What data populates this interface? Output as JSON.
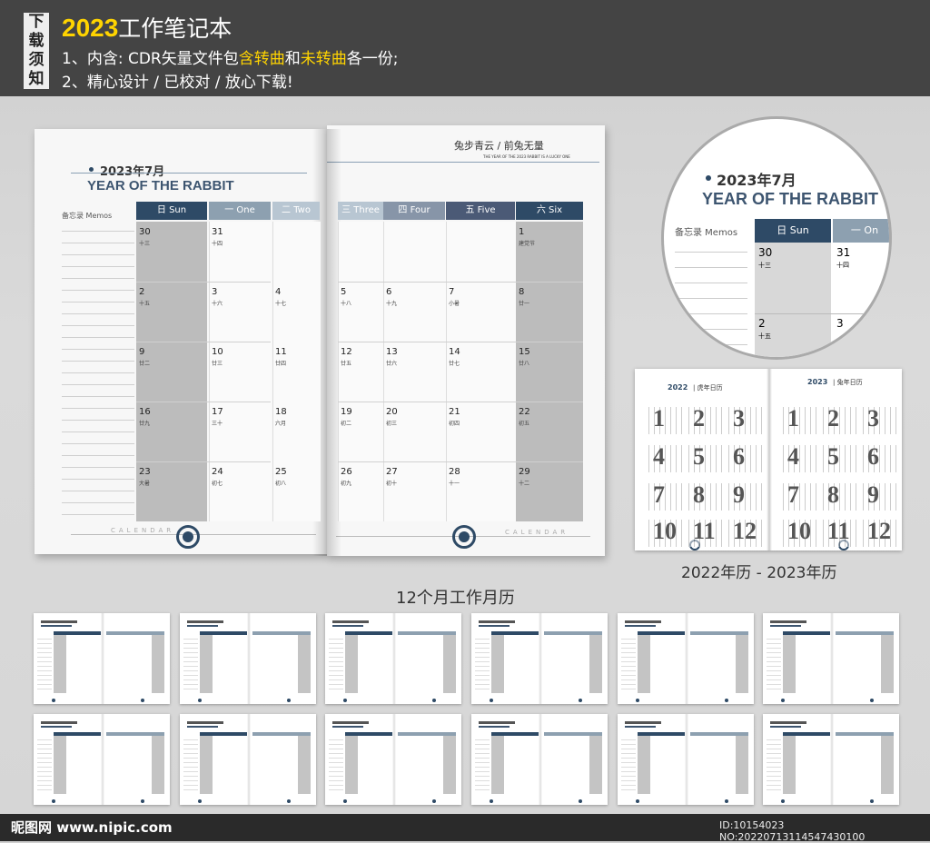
{
  "banner": {
    "side_tag": [
      "下",
      "载",
      "须",
      "知"
    ],
    "title_year": "2023",
    "title_rest": "工作笔记本",
    "line1_a": "1、内含: CDR矢量文件包",
    "line1_hl1": "含转曲",
    "line1_b": "和",
    "line1_hl2": "未转曲",
    "line1_c": "各一份;",
    "line2": "2、精心设计 / 已校对 / 放心下载!"
  },
  "left_page": {
    "date_title": "2023年7月",
    "year_title": "YEAR OF THE RABBIT",
    "memo_label": "备忘录 Memos",
    "footer": "CALENDAR"
  },
  "right_page": {
    "slogan": "兔步青云 / 前兔无量",
    "slogan_sub": "THE YEAR OF THE 2023 RABBIT IS A LUCKY ONE",
    "footer": "CALENDAR"
  },
  "weekdays": [
    {
      "label": "日 Sun",
      "color": "#2e4a66"
    },
    {
      "label": "一 One",
      "color": "#8da0b0"
    },
    {
      "label": "二 Two",
      "color": "#b8c6d2"
    },
    {
      "label": "三 Three",
      "color": "#b8c6d2"
    },
    {
      "label": "四 Four",
      "color": "#8795a8"
    },
    {
      "label": "五 Five",
      "color": "#4b5a76"
    },
    {
      "label": "六 Six",
      "color": "#2e4a66"
    }
  ],
  "weeks": [
    [
      [
        "30",
        "十三"
      ],
      [
        "31",
        "十四"
      ],
      [
        "",
        ""
      ],
      [
        "",
        ""
      ],
      [
        "",
        ""
      ],
      [
        "",
        ""
      ],
      [
        "1",
        "建党节"
      ]
    ],
    [
      [
        "2",
        "十五"
      ],
      [
        "3",
        "十六"
      ],
      [
        "4",
        "十七"
      ],
      [
        "5",
        "十八"
      ],
      [
        "6",
        "十九"
      ],
      [
        "7",
        "小暑"
      ],
      [
        "8",
        "廿一"
      ]
    ],
    [
      [
        "9",
        "廿二"
      ],
      [
        "10",
        "廿三"
      ],
      [
        "11",
        "廿四"
      ],
      [
        "12",
        "廿五"
      ],
      [
        "13",
        "廿六"
      ],
      [
        "14",
        "廿七"
      ],
      [
        "15",
        "廿八"
      ]
    ],
    [
      [
        "16",
        "廿九"
      ],
      [
        "17",
        "三十"
      ],
      [
        "18",
        "六月"
      ],
      [
        "19",
        "初二"
      ],
      [
        "20",
        "初三"
      ],
      [
        "21",
        "初四"
      ],
      [
        "22",
        "初五"
      ]
    ],
    [
      [
        "23",
        "大暑"
      ],
      [
        "24",
        "初七"
      ],
      [
        "25",
        "初八"
      ],
      [
        "26",
        "初九"
      ],
      [
        "27",
        "初十"
      ],
      [
        "28",
        "十一"
      ],
      [
        "29",
        "十二"
      ]
    ]
  ],
  "zoom": {
    "date_title": "2023年7月",
    "year_title": "YEAR OF THE RABBIT",
    "memo_label": "备忘录 Memos",
    "sun": "日 Sun",
    "one": "一 On",
    "d30": "30",
    "l30": "十三",
    "d31": "31",
    "l31": "十四",
    "d2": "2",
    "l2": "十五",
    "d3": "3"
  },
  "year_calendar": {
    "left_year": "2022",
    "left_title": "| 虎年日历",
    "right_year": "2023",
    "right_title": "| 兔年日历",
    "months": [
      "1",
      "2",
      "3",
      "4",
      "5",
      "6",
      "7",
      "8",
      "9",
      "10",
      "11",
      "12"
    ]
  },
  "captions": {
    "year_cal": "2022年历 - 2023年历",
    "monthly": "12个月工作月历"
  },
  "footer": {
    "logo": "昵图网 www.nipic.com",
    "id": "ID:10154023 NO:20220713114547430100"
  }
}
